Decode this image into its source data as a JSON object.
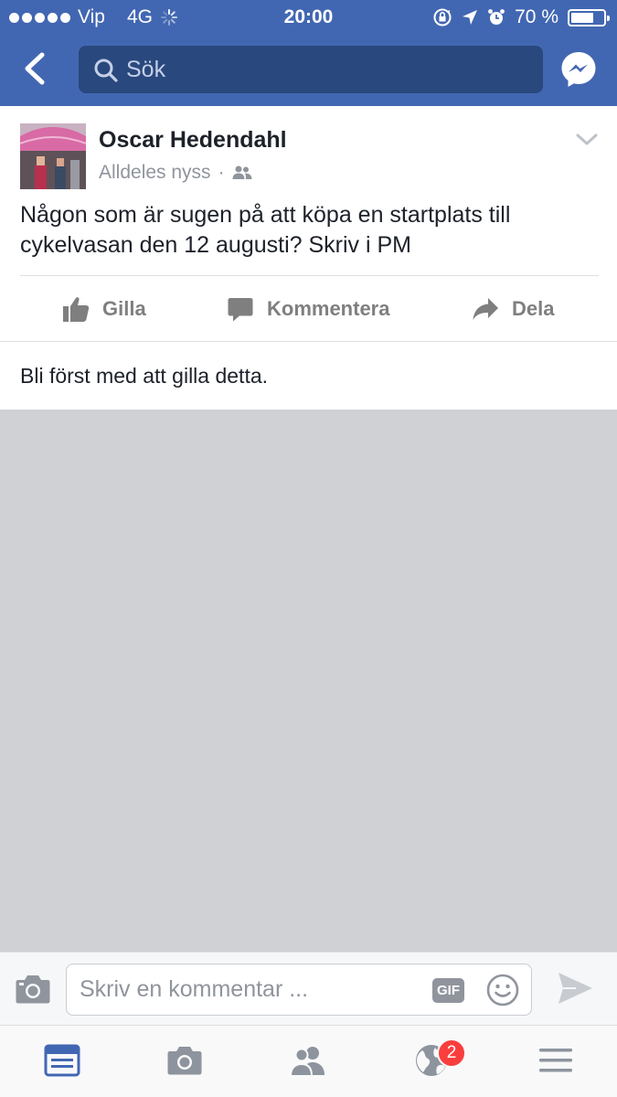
{
  "status_bar": {
    "carrier": "Vip",
    "network": "4G",
    "time": "20:00",
    "battery_text": "70 %",
    "battery_level": 0.7
  },
  "header": {
    "search_placeholder": "Sök",
    "accent_color": "#4267b2"
  },
  "post": {
    "author": "Oscar Hedendahl",
    "timestamp": "Alldeles nyss",
    "separator": "·",
    "audience_icon": "friends-icon",
    "text": "Någon som är sugen på att köpa en startplats till cykelvasan den 12 augusti? Skriv i PM",
    "actions": {
      "like": "Gilla",
      "comment": "Kommentera",
      "share": "Dela"
    },
    "likes_summary": "Bli först med att gilla detta."
  },
  "comment_bar": {
    "placeholder": "Skriv en kommentar ...",
    "gif_label": "GIF"
  },
  "tab_bar": {
    "tabs": [
      "news-feed-icon",
      "camera-icon",
      "friends-icon",
      "globe-icon",
      "menu-icon"
    ],
    "notification_count": "2"
  }
}
